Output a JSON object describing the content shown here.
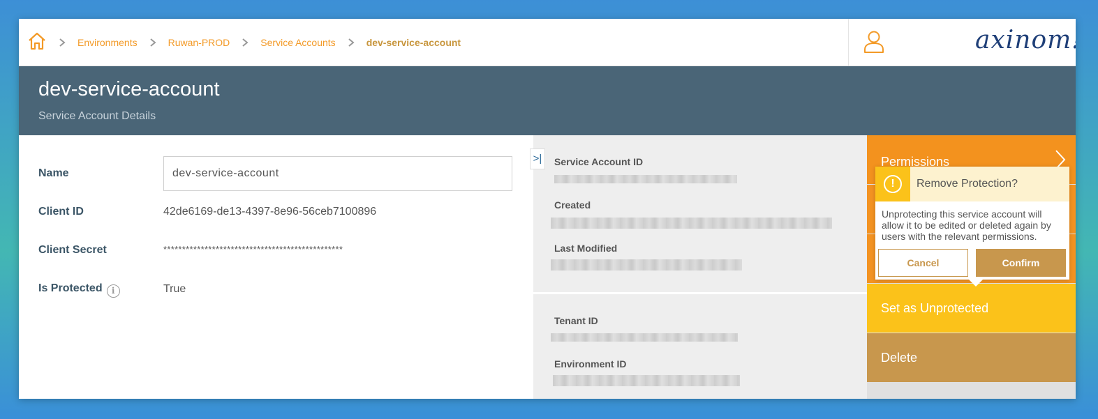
{
  "breadcrumb": {
    "items": [
      "Environments",
      "Ruwan-PROD",
      "Service Accounts"
    ],
    "current": "dev-service-account"
  },
  "logo": {
    "text": "axinom!"
  },
  "header": {
    "title": "dev-service-account",
    "subtitle": "Service Account Details"
  },
  "form": {
    "name_label": "Name",
    "name_value": "dev-service-account",
    "client_id_label": "Client ID",
    "client_id_value": "42de6169-de13-4397-8e96-56ceb7100896",
    "client_secret_label": "Client Secret",
    "client_secret_value": "************************************************",
    "is_protected_label": "Is Protected",
    "is_protected_value": "True"
  },
  "details": {
    "service_account_id_label": "Service Account ID",
    "created_label": "Created",
    "last_modified_label": "Last Modified",
    "tenant_id_label": "Tenant ID",
    "environment_id_label": "Environment ID",
    "collapse_glyph": ">|"
  },
  "actions": {
    "permissions": "Permissions",
    "set_unprotected": "Set as Unprotected",
    "delete": "Delete"
  },
  "popover": {
    "title": "Remove Protection?",
    "message": "Unprotecting this service account will allow it to be edited or deleted again by users with the relevant permissions.",
    "cancel": "Cancel",
    "confirm": "Confirm",
    "warn_glyph": "!"
  },
  "colors": {
    "accent_orange": "#f3921e",
    "warning_yellow": "#fbc21a",
    "gold": "#c8974d",
    "header_slate": "#4a6577"
  }
}
